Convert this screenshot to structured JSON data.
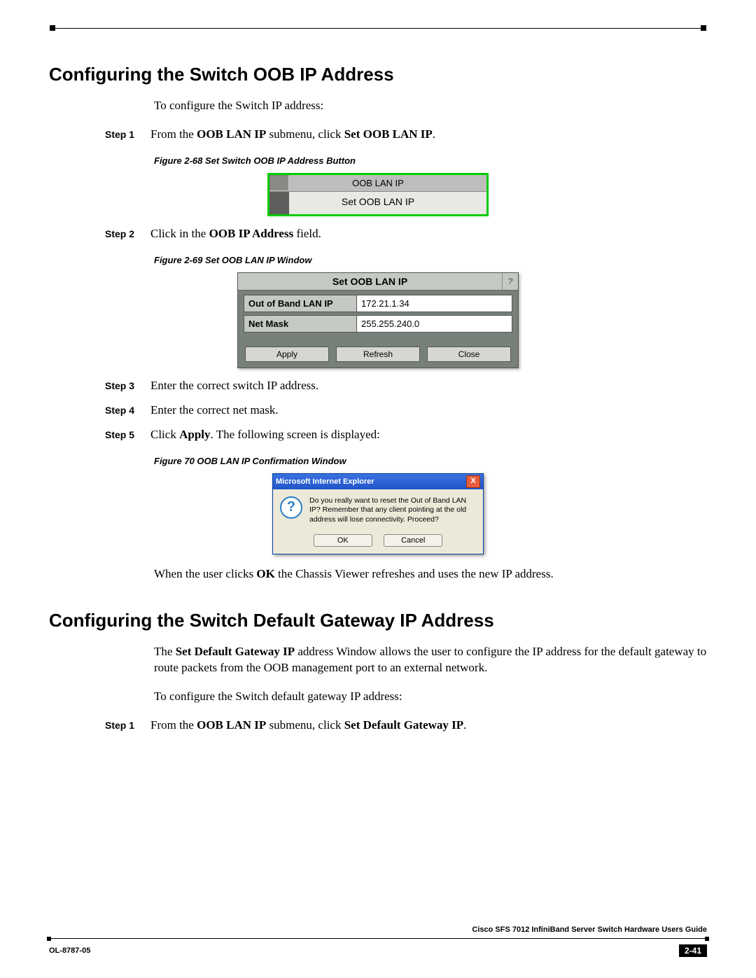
{
  "section1": {
    "heading": "Configuring the Switch OOB IP Address",
    "intro": "To configure the Switch IP address:",
    "step1": {
      "label": "Step 1",
      "text_a": "From the ",
      "bold_a": "OOB LAN IP",
      "text_b": " submenu, click ",
      "bold_b": "Set OOB LAN IP",
      "text_c": "."
    },
    "fig68_caption": "Figure 2-68   Set Switch OOB IP Address Button",
    "fig68": {
      "tab": "OOB LAN IP",
      "item": "Set OOB LAN IP"
    },
    "step2": {
      "label": "Step 2",
      "text_a": "Click in the ",
      "bold_a": "OOB IP Address",
      "text_b": " field."
    },
    "fig69_caption": "Figure 2-69   Set OOB LAN IP Window",
    "fig69": {
      "title": "Set OOB LAN IP",
      "help": "?",
      "row1_label": "Out of Band LAN IP",
      "row1_value": "172.21.1.34",
      "row2_label": "Net Mask",
      "row2_value": "255.255.240.0",
      "btn_apply": "Apply",
      "btn_refresh": "Refresh",
      "btn_close": "Close"
    },
    "step3": {
      "label": "Step 3",
      "text": "Enter the correct switch IP address."
    },
    "step4": {
      "label": "Step 4",
      "text": "Enter the correct net mask."
    },
    "step5": {
      "label": "Step 5",
      "text_a": "Click ",
      "bold_a": "Apply",
      "text_b": ". The following screen is displayed:"
    },
    "fig70_caption": "Figure 70        OOB LAN IP Confirmation Window",
    "fig70": {
      "titlebar": "Microsoft Internet Explorer",
      "close_x": "X",
      "icon": "?",
      "message": "Do you really want to reset the Out of Band LAN IP? Remember that any client pointing at the old address will lose connectivity.  Proceed?",
      "btn_ok": "OK",
      "btn_cancel": "Cancel"
    },
    "after_fig70_a": "When the user clicks ",
    "after_fig70_bold": "OK",
    "after_fig70_b": " the Chassis Viewer refreshes and uses the new IP address."
  },
  "section2": {
    "heading": "Configuring the Switch Default Gateway IP Address",
    "para_a": "The ",
    "para_bold": "Set Default Gateway IP",
    "para_b": " address Window allows the user to configure the IP address for the default gateway to route packets from the OOB management port to an external network.",
    "intro": "To configure the Switch default gateway IP address:",
    "step1": {
      "label": "Step 1",
      "text_a": "From the ",
      "bold_a": "OOB LAN IP",
      "text_b": " submenu, click ",
      "bold_b": "Set Default Gateway IP",
      "text_c": "."
    }
  },
  "footer": {
    "doc_title": "Cisco SFS 7012 InfiniBand Server Switch Hardware Users Guide",
    "doc_id": "OL-8787-05",
    "page": "2-41"
  }
}
